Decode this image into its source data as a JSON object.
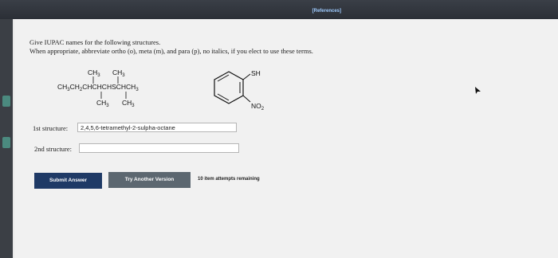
{
  "header": {
    "references_link": "[References]"
  },
  "instructions": {
    "line1": "Give IUPAC names for the following structures.",
    "line2": "When appropriate, abbreviate ortho (o), meta (m), and para (p), no italics, if you elect to use these terms."
  },
  "structure1": {
    "top_left": "CH",
    "top_right": "CH",
    "chain_parts": [
      "CH",
      "CH",
      "CHCHCHSCHCH"
    ],
    "bottom_left": "CH",
    "bottom_right": "CH",
    "subscript": "3",
    "subscript2": "2"
  },
  "structure2": {
    "sh_label": "SH",
    "no2_label": "NO",
    "no2_sub": "2"
  },
  "answers": {
    "first_label": "1st structure:",
    "first_value": "2,4,5,6-tetramethyl-2-sulpha-octane",
    "second_label": "2nd structure:",
    "second_value": ""
  },
  "buttons": {
    "submit": "Submit Answer",
    "try_another": "Try Another Version"
  },
  "status": {
    "attempts": "10 item attempts remaining"
  }
}
